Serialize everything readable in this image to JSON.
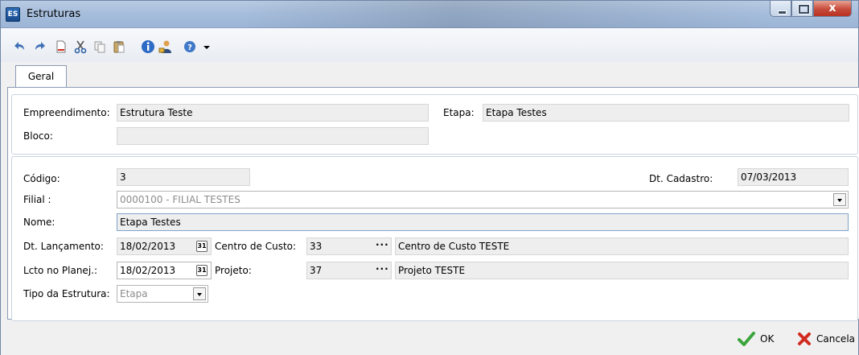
{
  "window": {
    "title": "Estruturas",
    "app_icon_text": "ES",
    "close_glyph": "x"
  },
  "toolbar": {
    "icons": [
      "undo-icon",
      "redo-icon",
      "new-document-icon",
      "cut-icon",
      "copy-icon",
      "paste-icon",
      "info-icon",
      "user-lock-icon",
      "help-icon",
      "dropdown-arrow-icon"
    ]
  },
  "tabs": [
    {
      "label": "Geral",
      "active": true
    }
  ],
  "group1": {
    "empreendimento_label": "Empreendimento:",
    "empreendimento_value": "Estrutura Teste",
    "etapa_label": "Etapa:",
    "etapa_value": "Etapa Testes",
    "bloco_label": "Bloco:",
    "bloco_value": ""
  },
  "group2": {
    "codigo_label": "Código:",
    "codigo_value": "3",
    "dt_cadastro_label": "Dt. Cadastro:",
    "dt_cadastro_value": "07/03/2013",
    "filial_label": "Filial :",
    "filial_value": "0000100 - FILIAL TESTES",
    "nome_label": "Nome:",
    "nome_value": "Etapa Testes",
    "dt_lancamento_label": "Dt. Lançamento:",
    "dt_lancamento_value": "18/02/2013",
    "centro_custo_label": "Centro de Custo:",
    "centro_custo_code": "33",
    "centro_custo_desc": "Centro de Custo TESTE",
    "lcto_planej_label": "Lcto no Planej.:",
    "lcto_planej_value": "18/02/2013",
    "projeto_label": "Projeto:",
    "projeto_code": "37",
    "projeto_desc": "Projeto TESTE",
    "tipo_estrutura_label": "Tipo da Estrutura:",
    "tipo_estrutura_value": "Etapa",
    "ellipsis": "···",
    "calendar_glyph": "31"
  },
  "footer": {
    "ok_label": "OK",
    "cancel_label": "Cancela"
  },
  "colors": {
    "titlebar": "#a7bedc",
    "field_bg": "#eeeeee",
    "ok_check": "#3aa53a",
    "cancel_x": "#d12b1f"
  }
}
